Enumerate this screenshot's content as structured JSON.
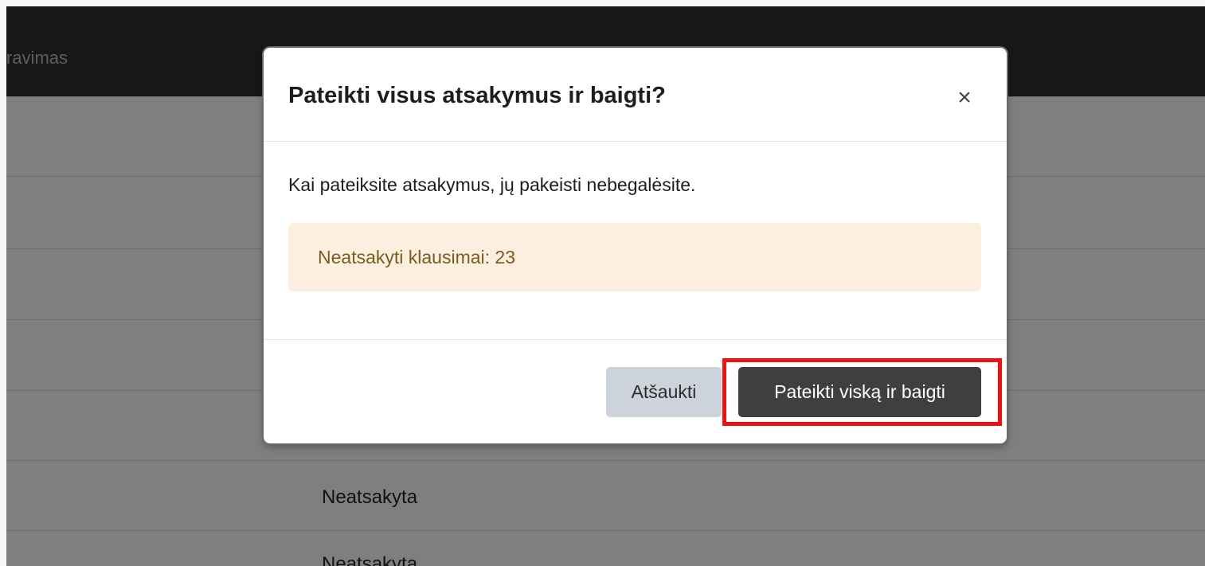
{
  "header": {
    "title_fragment": "ravimas"
  },
  "background_rows": [
    {
      "text": ""
    },
    {
      "text": ""
    },
    {
      "text": ""
    },
    {
      "text": ""
    },
    {
      "text": ""
    },
    {
      "text": "Neatsakyta"
    },
    {
      "text": "Neatsakyta"
    }
  ],
  "modal": {
    "title": "Pateikti visus atsakymus ir baigti?",
    "close_symbol": "×",
    "message": "Kai pateiksite atsakymus, jų pakeisti nebegalėsite.",
    "alert_text": "Neatsakyti klausimai: 23",
    "cancel_label": "Atšaukti",
    "submit_label": "Pateikti viską ir baigti"
  },
  "colors": {
    "highlight": "#ee1111",
    "submit_bg": "#3f3f3f",
    "cancel_bg": "#cdd3db",
    "alert_bg": "#fcefdf"
  }
}
